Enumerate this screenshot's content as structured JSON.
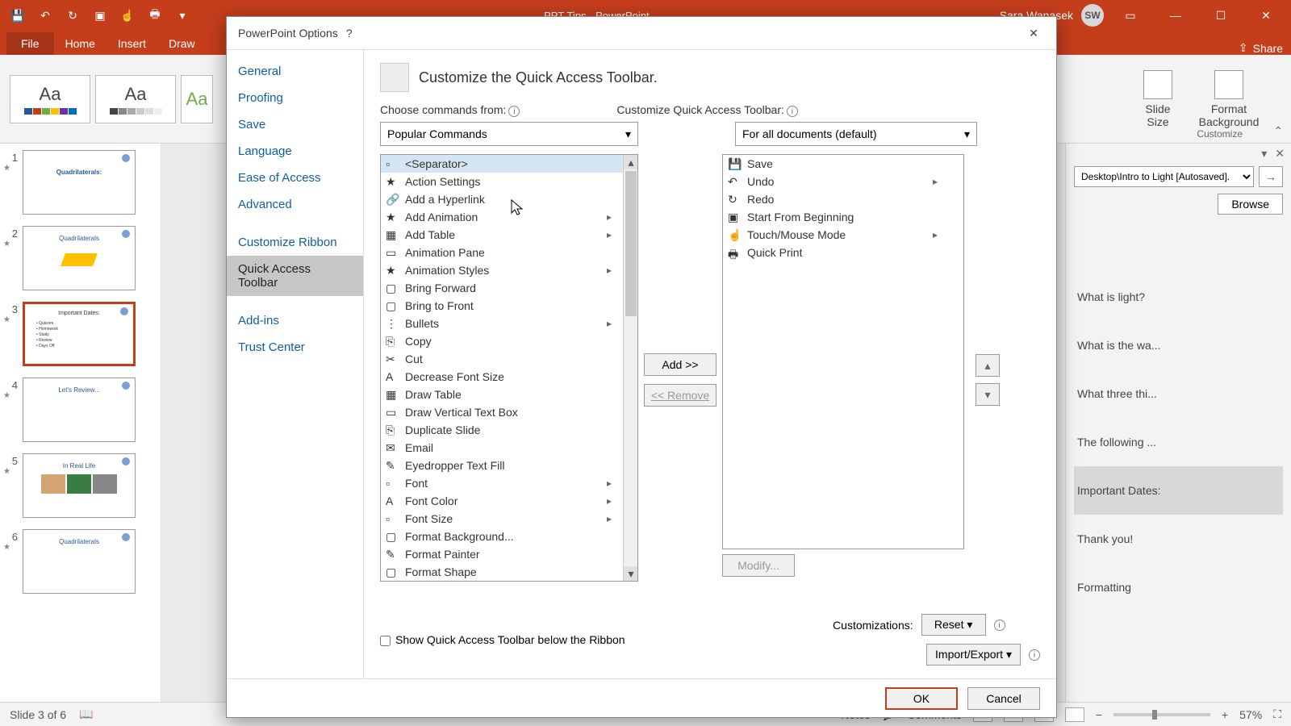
{
  "titlebar": {
    "title": "PPT Tips - PowerPoint",
    "user": "Sara Wanasek",
    "initials": "SW"
  },
  "ribbon": {
    "tabs": [
      "File",
      "Home",
      "Insert",
      "Draw"
    ],
    "share": "Share",
    "slideSize": "Slide\nSize",
    "formatBg": "Format\nBackground",
    "groupLabel": "Customize"
  },
  "rpanel": {
    "path": "Desktop\\Intro to Light [Autosaved].",
    "browse": "Browse",
    "items": [
      "What is light?",
      "What is the wa...",
      "What three thi...",
      "The following ...",
      "Important Dates:",
      "Thank you!",
      "Formatting"
    ]
  },
  "status": {
    "slide": "Slide 3 of 6",
    "notes": "Notes",
    "comments": "Comments",
    "zoom": "57%"
  },
  "dialog": {
    "title": "PowerPoint Options",
    "side": [
      "General",
      "Proofing",
      "Save",
      "Language",
      "Ease of Access",
      "Advanced",
      "",
      "Customize Ribbon",
      "Quick Access Toolbar",
      "",
      "Add-ins",
      "Trust Center"
    ],
    "sideSelected": "Quick Access Toolbar",
    "heading": "Customize the Quick Access Toolbar.",
    "chooseLabel": "Choose commands from:",
    "chooseValue": "Popular Commands",
    "customizeLabel": "Customize Quick Access Toolbar:",
    "customizeValue": "For all documents (default)",
    "leftList": [
      "<Separator>",
      "Action Settings",
      "Add a Hyperlink",
      "Add Animation",
      "Add Table",
      "Animation Pane",
      "Animation Styles",
      "Bring Forward",
      "Bring to Front",
      "Bullets",
      "Copy",
      "Cut",
      "Decrease Font Size",
      "Draw Table",
      "Draw Vertical Text Box",
      "Duplicate Slide",
      "Email",
      "Eyedropper Text Fill",
      "Font",
      "Font Color",
      "Font Size",
      "Format Background...",
      "Format Painter",
      "Format Shape"
    ],
    "leftSelected": "<Separator>",
    "leftSubmenu": {
      "Add Animation": true,
      "Add Table": true,
      "Animation Styles": true,
      "Bullets": true,
      "Font": true,
      "Font Color": true,
      "Font Size": true
    },
    "rightList": [
      "Save",
      "Undo",
      "Redo",
      "Start From Beginning",
      "Touch/Mouse Mode",
      "Quick Print"
    ],
    "rightSubmenu": {
      "Undo": true,
      "Touch/Mouse Mode": true
    },
    "addBtn": "Add >>",
    "removeBtn": "<< Remove",
    "modifyBtn": "Modify...",
    "showBelow": "Show Quick Access Toolbar below the Ribbon",
    "customizations": "Customizations:",
    "reset": "Reset",
    "importExport": "Import/Export",
    "ok": "OK",
    "cancel": "Cancel"
  },
  "thumbs": [
    {
      "n": "1",
      "title": "Quadrilaterals:"
    },
    {
      "n": "2",
      "title": "Quadrilaterals"
    },
    {
      "n": "3",
      "title": "Important Dates:"
    },
    {
      "n": "4",
      "title": "Let's Review..."
    },
    {
      "n": "5",
      "title": "In Real Life"
    },
    {
      "n": "6",
      "title": "Quadrilaterals"
    }
  ]
}
